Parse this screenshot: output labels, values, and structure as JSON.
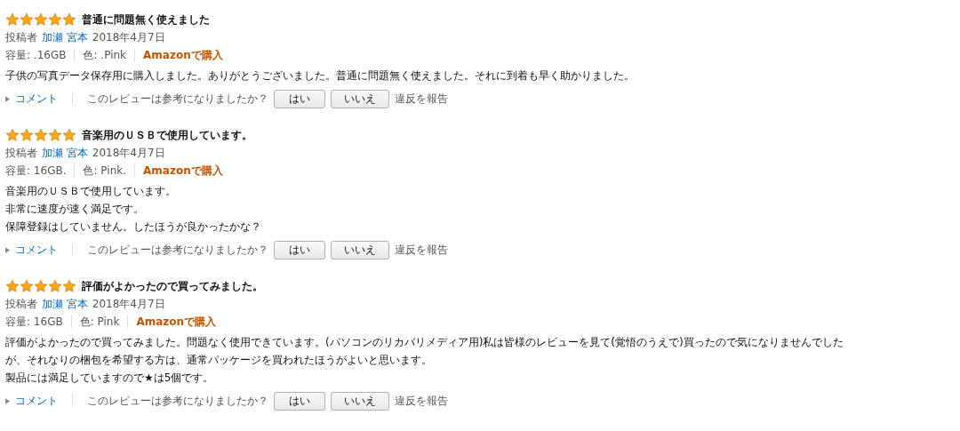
{
  "reviews": [
    {
      "stars": 5,
      "title": "普通に問題無く使えました",
      "by_label": "投稿者",
      "author": "加瀬 宮本",
      "date": "2018年4月7日",
      "specs": [
        "容量: .16GB",
        "色: .Pink"
      ],
      "verified": "Amazonで購入",
      "body": [
        "子供の写真データ保存用に購入しました。ありがとうございました。普通に問題無く使えました。それに到着も早く助かりました。"
      ],
      "comment": "コメント",
      "question": "このレビューは参考になりましたか？",
      "yes": "はい",
      "no": "いいえ",
      "report": "違反を報告"
    },
    {
      "stars": 5,
      "title": "音楽用のＵＳＢで使用しています。",
      "by_label": "投稿者",
      "author": "加瀬 宮本",
      "date": "2018年4月7日",
      "specs": [
        "容量: 16GB.",
        "色: Pink."
      ],
      "verified": "Amazonで購入",
      "body": [
        "音楽用のＵＳＢで使用しています。",
        "非常に速度が速く満足です。",
        "保障登録はしていません。したほうが良かったかな？"
      ],
      "comment": "コメント",
      "question": "このレビューは参考になりましたか？",
      "yes": "はい",
      "no": "いいえ",
      "report": "違反を報告"
    },
    {
      "stars": 5,
      "title": "評価がよかったので買ってみました。",
      "by_label": "投稿者",
      "author": "加瀬 宮本",
      "date": "2018年4月7日",
      "specs": [
        "容量: 16GB",
        "色: Pink"
      ],
      "verified": "Amazonで購入",
      "body": [
        "評価がよかったので買ってみました。問題なく使用できています。(パソコンのリカバリメディア用)私は皆様のレビューを見て(覚悟のうえで)買ったので気になりませんでした",
        "が、それなりの梱包を希望する方は、通常パッケージを買われたほうがよいと思います。",
        "製品には満足していますので★は5個です。"
      ],
      "comment": "コメント",
      "question": "このレビューは参考になりましたか？",
      "yes": "はい",
      "no": "いいえ",
      "report": "違反を報告"
    }
  ]
}
